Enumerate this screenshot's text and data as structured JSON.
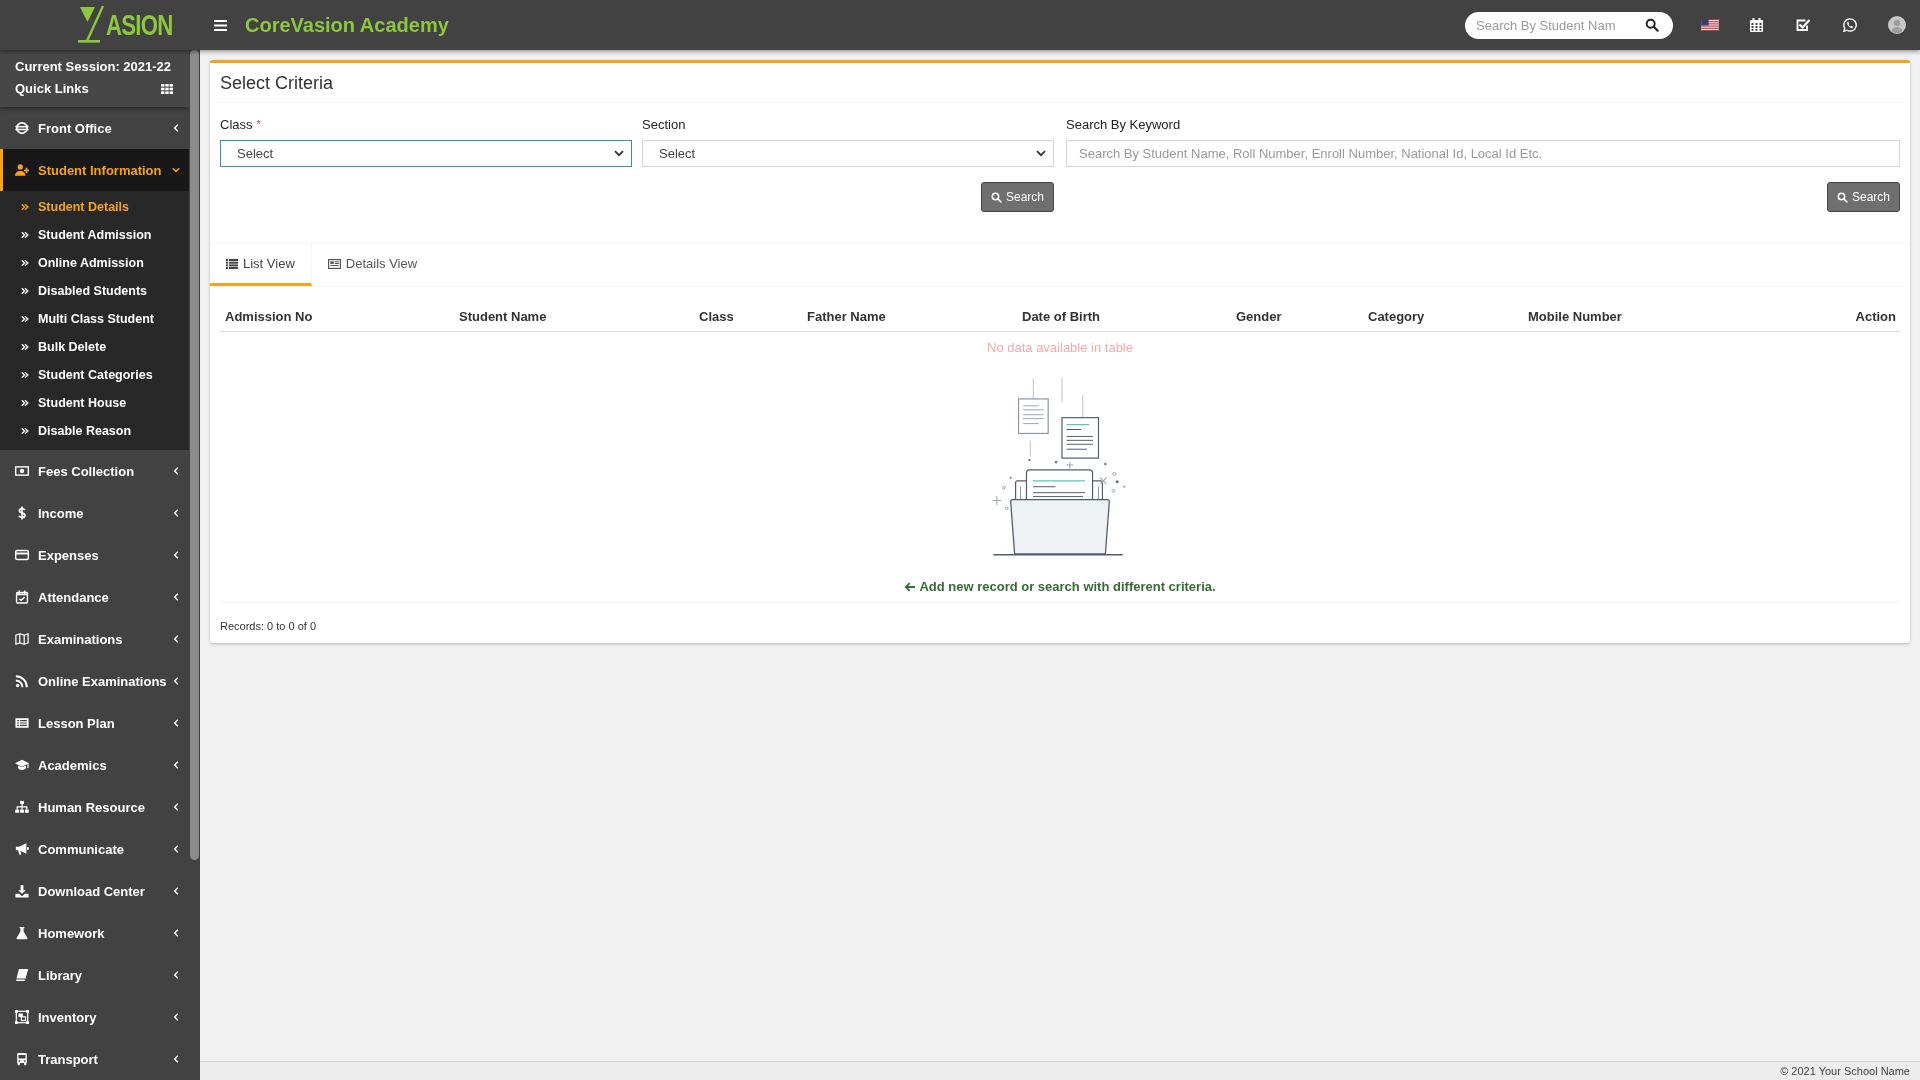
{
  "header": {
    "logo_text": "ASION",
    "title": "CoreVasion Academy",
    "search": {
      "placeholder": "Search By Student Nam"
    }
  },
  "sidebar": {
    "session": "Current Session: 2021-22",
    "quick_links": "Quick Links",
    "menu": [
      {
        "label": "Front Office",
        "selected": false,
        "expanded": false
      },
      {
        "label": "Student Information",
        "selected": true,
        "expanded": true,
        "children": [
          {
            "label": "Student Details",
            "selected": true
          },
          {
            "label": "Student Admission",
            "selected": false
          },
          {
            "label": "Online Admission",
            "selected": false
          },
          {
            "label": "Disabled Students",
            "selected": false
          },
          {
            "label": "Multi Class Student",
            "selected": false
          },
          {
            "label": "Bulk Delete",
            "selected": false
          },
          {
            "label": "Student Categories",
            "selected": false
          },
          {
            "label": "Student House",
            "selected": false
          },
          {
            "label": "Disable Reason",
            "selected": false
          }
        ]
      },
      {
        "label": "Fees Collection",
        "selected": false,
        "expanded": false
      },
      {
        "label": "Income",
        "selected": false,
        "expanded": false
      },
      {
        "label": "Expenses",
        "selected": false,
        "expanded": false
      },
      {
        "label": "Attendance",
        "selected": false,
        "expanded": false
      },
      {
        "label": "Examinations",
        "selected": false,
        "expanded": false
      },
      {
        "label": "Online Examinations",
        "selected": false,
        "expanded": false
      },
      {
        "label": "Lesson Plan",
        "selected": false,
        "expanded": false
      },
      {
        "label": "Academics",
        "selected": false,
        "expanded": false
      },
      {
        "label": "Human Resource",
        "selected": false,
        "expanded": false
      },
      {
        "label": "Communicate",
        "selected": false,
        "expanded": false
      },
      {
        "label": "Download Center",
        "selected": false,
        "expanded": false
      },
      {
        "label": "Homework",
        "selected": false,
        "expanded": false
      },
      {
        "label": "Library",
        "selected": false,
        "expanded": false
      },
      {
        "label": "Inventory",
        "selected": false,
        "expanded": false
      },
      {
        "label": "Transport",
        "selected": false,
        "expanded": false
      }
    ]
  },
  "criteria": {
    "title": "Select Criteria",
    "groups": [
      {
        "fields": [
          {
            "kind": "select",
            "label": "Class",
            "required_mark": "*",
            "value": "Select",
            "focused": true
          },
          {
            "kind": "select",
            "label": "Section",
            "value": "Select",
            "focused": false
          }
        ],
        "button": "Search"
      },
      {
        "fields": [
          {
            "kind": "text",
            "label": "Search By Keyword",
            "placeholder": "Search By Student Name, Roll Number, Enroll Number, National Id, Local Id Etc.",
            "focused": false
          }
        ],
        "button": "Search"
      }
    ]
  },
  "tabs": [
    {
      "label": "List View",
      "selected": true
    },
    {
      "label": "Details View",
      "selected": false
    }
  ],
  "table": {
    "columns": [
      "Admission No",
      "Student Name",
      "Class",
      "Father Name",
      "Date of Birth",
      "Gender",
      "Category",
      "Mobile Number",
      "Action"
    ],
    "empty_message": "No data available in table",
    "hint": "Add new record or search with different criteria.",
    "records": "Records: 0 to 0 of 0"
  },
  "footer": "© 2021 Your School Name"
}
